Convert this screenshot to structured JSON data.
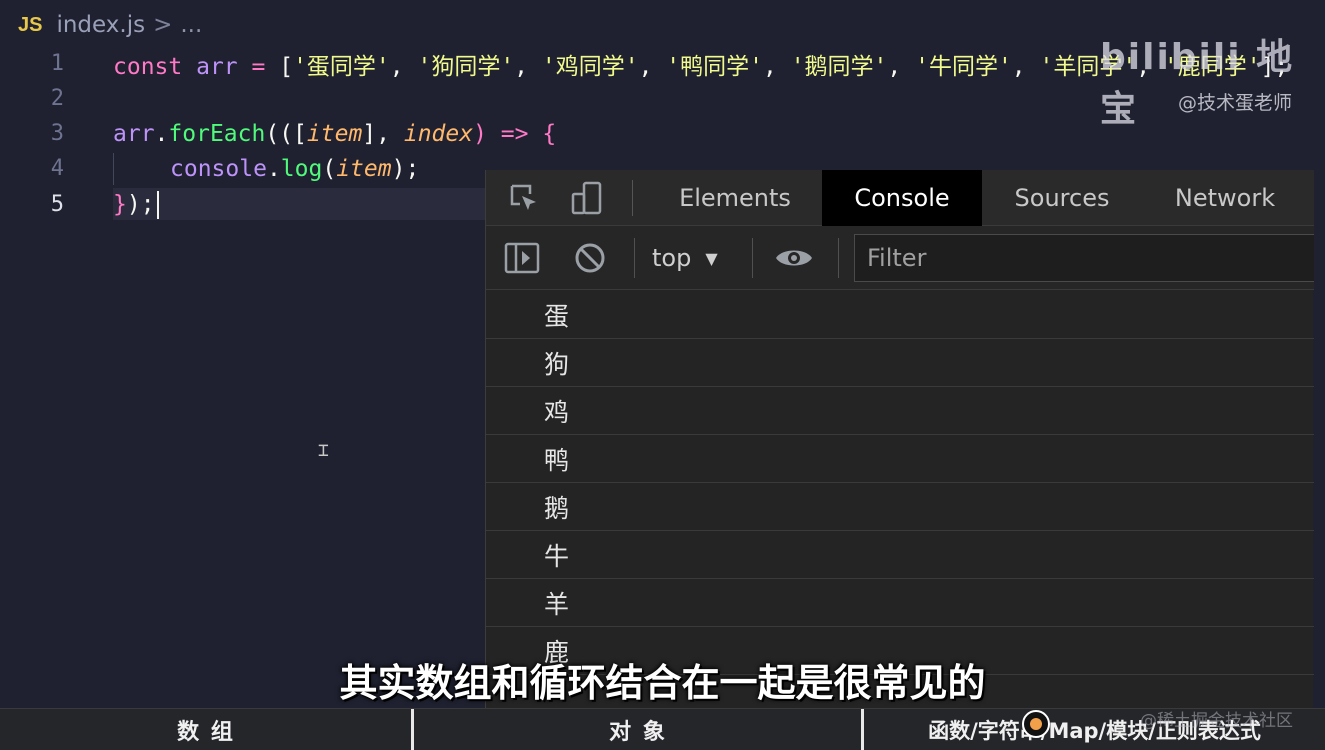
{
  "breadcrumb": {
    "lang_badge": "JS",
    "file": "index.js",
    "separator": ">",
    "more": "..."
  },
  "editor": {
    "lines": [
      {
        "num": "1"
      },
      {
        "num": "2"
      },
      {
        "num": "3"
      },
      {
        "num": "4"
      },
      {
        "num": "5"
      }
    ],
    "tokens": {
      "const": "const",
      "arr": "arr",
      "eq": " = ",
      "open_bracket": "[",
      "items": [
        "'蛋同学'",
        "'狗同学'",
        "'鸡同学'",
        "'鸭同学'",
        "'鹅同学'",
        "'牛同学'",
        "'羊同学'",
        "'鹿同学'"
      ],
      "comma": ", ",
      "close_bracket": "];",
      "arr2": "arr",
      "dot": ".",
      "forEach": "forEach",
      "paren_open": "((",
      "bracket_open": "[",
      "item": "item",
      "bracket_close": "], ",
      "index": "index",
      "arrow": ") => {",
      "console": "console",
      "log": "log",
      "log_open": "(",
      "item2": "item",
      "log_close": ");",
      "closing_brace": "}",
      "closing_rest": ");"
    }
  },
  "watermark": {
    "logo": "bilibili 地宝",
    "uploader": "@技术蛋老师"
  },
  "devtools": {
    "tabs": [
      {
        "label": "Elements"
      },
      {
        "label": "Console"
      },
      {
        "label": "Sources"
      },
      {
        "label": "Network"
      }
    ],
    "context": "top",
    "filter_placeholder": "Filter",
    "logs": [
      "蛋",
      "狗",
      "鸡",
      "鸭",
      "鹅",
      "牛",
      "羊",
      "鹿"
    ]
  },
  "subtitle": "其实数组和循环结合在一起是很常见的",
  "chapters": [
    "数 组",
    "对 象",
    "函数/字符串/Map/模块/正则表达式"
  ],
  "site_watermark": "@稀土掘金技术社区"
}
